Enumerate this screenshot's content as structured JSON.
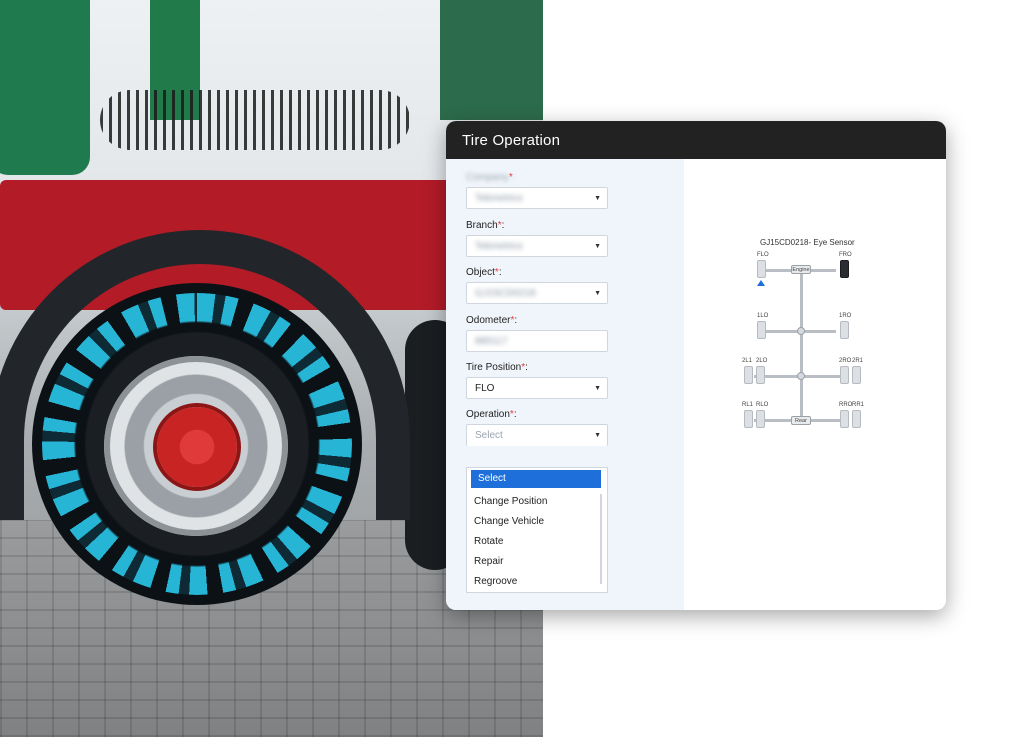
{
  "panel": {
    "title": "Tire  Operation"
  },
  "form": {
    "company": {
      "label": "Company",
      "value": "Tekmetrics"
    },
    "branch": {
      "label": "Branch",
      "value": "Tekmetrics"
    },
    "object": {
      "label": "Object",
      "value": "GJ15CD0218"
    },
    "odometer": {
      "label": "Odometer",
      "value": "885117"
    },
    "tire_position": {
      "label": "Tire Position",
      "value": "FLO"
    },
    "operation": {
      "label": "Operation",
      "placeholder": "Select"
    },
    "required_mark": "*",
    "label_suffix": ":"
  },
  "dropdown": {
    "options": [
      "Select",
      "Change Position",
      "Change Vehicle",
      "Rotate",
      "Repair",
      "Regroove"
    ],
    "selected_index": 0
  },
  "diagram": {
    "title": "GJ15CD0218- Eye Sensor",
    "front_hub": "Engine",
    "rear_hub": "Rear",
    "labels": {
      "flo": "FLO",
      "fro": "FRO",
      "1lo": "1LO",
      "1ro": "1RO",
      "2l1": "2L1",
      "2lo": "2LO",
      "2ro": "2RO",
      "2r1": "2R1",
      "rl1": "RL1",
      "rlo": "RLO",
      "rro": "RRO",
      "rr1": "RR1"
    }
  }
}
